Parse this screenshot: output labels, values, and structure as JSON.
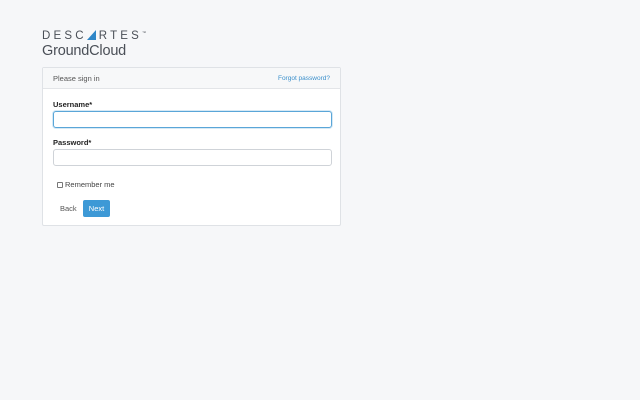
{
  "brand": {
    "top_left": "DESC",
    "top_right": "RTES",
    "trademark": "™",
    "product": "GroundCloud",
    "accent_color": "#2e86c8"
  },
  "signin": {
    "title": "Please sign in",
    "forgot_password": "Forgot password?",
    "username_label": "Username*",
    "username_value": "",
    "password_label": "Password*",
    "password_value": "",
    "remember_label": "Remember me",
    "remember_checked": false,
    "back_label": "Back",
    "next_label": "Next",
    "primary_color": "#3d99d6"
  }
}
